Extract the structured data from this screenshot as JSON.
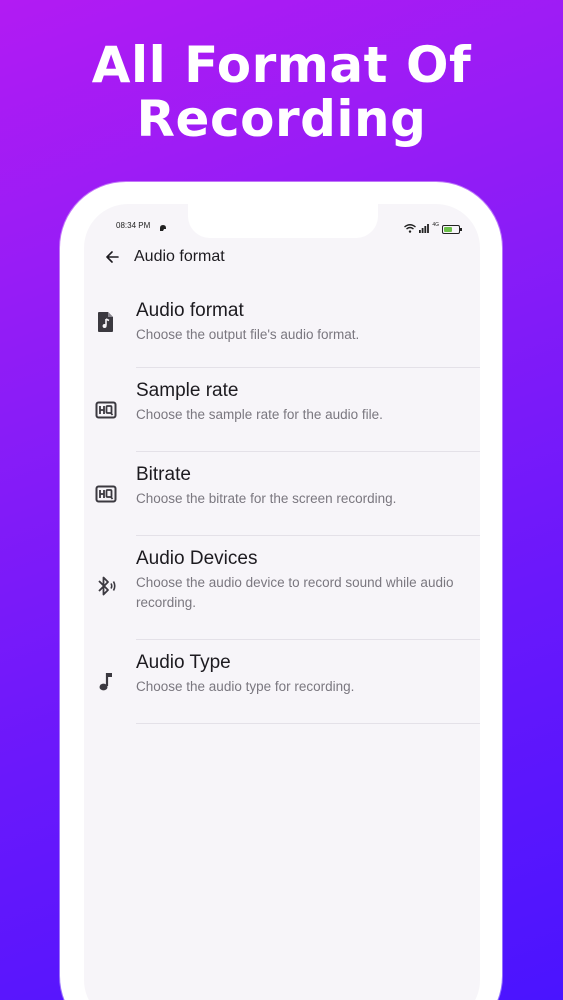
{
  "promo": {
    "title_line1": "All Format Of",
    "title_line2": "Recording"
  },
  "status_bar": {
    "time": "08:34 PM",
    "network": "4G",
    "battery_level": 0.55
  },
  "app_bar": {
    "title": "Audio format"
  },
  "settings": [
    {
      "title": "Audio format",
      "description": "Choose the output file's audio format.",
      "icon": "audio-file-icon"
    },
    {
      "title": "Sample rate",
      "description": "Choose the sample rate for the audio file.",
      "icon": "hq-icon"
    },
    {
      "title": "Bitrate",
      "description": "Choose the bitrate for the screen recording.",
      "icon": "hq-icon"
    },
    {
      "title": "Audio Devices",
      "description": "Choose the audio device to record sound while audio recording.",
      "icon": "bluetooth-audio-icon"
    },
    {
      "title": "Audio Type",
      "description": "Choose the audio type for recording.",
      "icon": "music-note-icon"
    }
  ],
  "colors": {
    "gradient_start": "#b21bf3",
    "gradient_end": "#4a14ff",
    "screen_bg": "#f7f5f9",
    "battery_fill": "#6cc04a"
  }
}
